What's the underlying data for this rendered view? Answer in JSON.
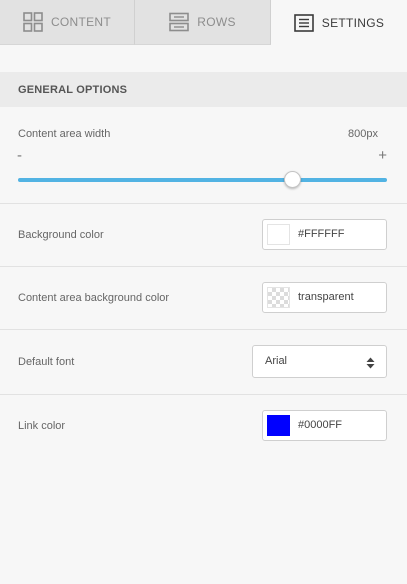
{
  "tabs": [
    {
      "label": "CONTENT",
      "icon": "grid-icon",
      "active": false
    },
    {
      "label": "ROWS",
      "icon": "rows-icon",
      "active": false
    },
    {
      "label": "SETTINGS",
      "icon": "settings-list-icon",
      "active": true
    }
  ],
  "section": {
    "title": "GENERAL OPTIONS"
  },
  "content_width": {
    "label": "Content area width",
    "value": "800px",
    "minus": "-",
    "plus": "+",
    "slider_fraction": 0.745,
    "track_color": "#52b3e3"
  },
  "background_color": {
    "label": "Background color",
    "value": "#FFFFFF",
    "swatch": "#FFFFFF"
  },
  "content_area_background": {
    "label": "Content area background color",
    "value": "transparent",
    "swatch": "transparent"
  },
  "default_font": {
    "label": "Default font",
    "value": "Arial"
  },
  "link_color": {
    "label": "Link color",
    "value": "#0000FF",
    "swatch": "#0000FF"
  }
}
